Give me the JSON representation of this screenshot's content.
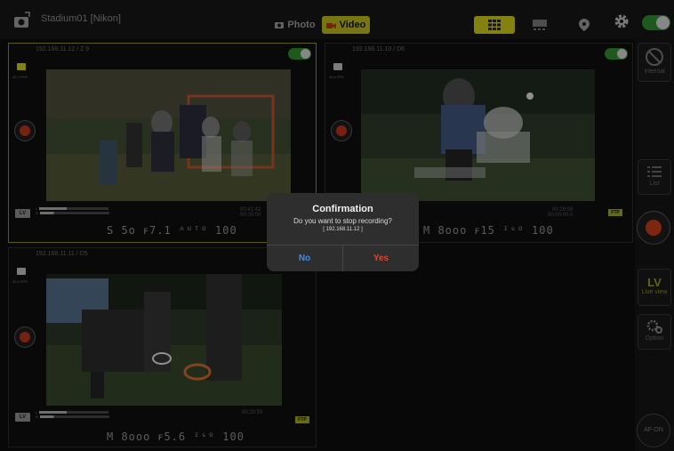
{
  "header": {
    "title": "Stadium01 [Nikon]",
    "photo_label": "Photo",
    "video_label": "Video"
  },
  "panels": [
    {
      "label": "192.168.11.12 / Z 9",
      "fps": "30.0 FPS",
      "lv_label": "LV",
      "timecode1": "00:41:42",
      "timecode2": "00:00:00",
      "status": "S   5o ꜰ7.1 ᴬᵁᵀᴼ 100",
      "active": true
    },
    {
      "label": "192.168.11.10 / D6",
      "fps": "30.0 FPS",
      "timecode1": "00:29:59",
      "timecode2": "00:00:00.0",
      "ftp": "FTP",
      "status": "M  8ooo ꜰ15 ᴵˢᴼ 100",
      "active": false
    },
    {
      "label": "192.168.11.11 / D5",
      "fps": "30.0 FPS",
      "lv_label": "LV",
      "timecode1": "00:29:59",
      "ftp": "FTP",
      "status": "M  8ooo ꜰ5.6 ᴵˢᴼ 100",
      "active": false
    }
  ],
  "sidebar": {
    "internal_label": "Internal",
    "list_label": "List",
    "lv_big": "LV",
    "live_view_label": "Live view",
    "option_label": "Option",
    "af_on_label": "AF-ON"
  },
  "dialog": {
    "title": "Confirmation",
    "message": "Do you want to stop recording?",
    "ip": "[ 192.168.11.12 ]",
    "no_label": "No",
    "yes_label": "Yes"
  },
  "colors": {
    "accent": "#c9c61a",
    "record": "#c03c1a",
    "toggle": "#2e8b2e",
    "no": "#3f8fe6",
    "yes": "#e0452b"
  },
  "icons": [
    "camera-icon",
    "video-camera-icon",
    "grid-icon",
    "monitor-icon",
    "location-pin-icon",
    "gear-icon",
    "no-entry-icon",
    "list-icon",
    "option-gear-icon",
    "record-icon"
  ]
}
